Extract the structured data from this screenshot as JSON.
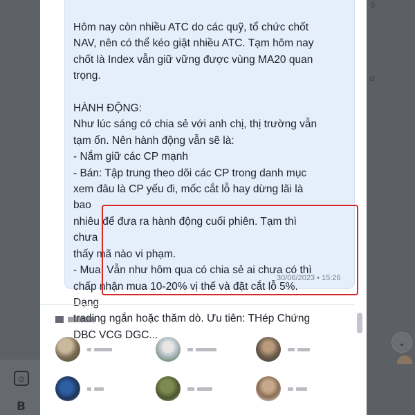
{
  "message": {
    "text": "Hôm nay còn nhiều ATC do các quỹ, tổ chức chốt\nNAV, nên có thể kéo giật nhiều ATC. Tạm hôm nay\nchốt là Index vẫn giữ vững được vùng MA20 quan\ntrọng.\n\nHÀNH ĐỘNG:\nNhư lúc sáng có chia sẻ với anh chị, thị trường vẫn\ntạm ổn. Nên hành động vẫn sẽ là:\n- Nắm giữ các CP mạnh\n- Bán: Tập trung theo dõi các CP trong danh mục\nxem đâu là CP yếu đi, mốc cắt lỗ hay dừng lãi là bao\nnhiêu để đưa ra hành động cuối phiên. Tạm thì chưa\nthấy mã nào vi phạm.\n- Mua: Vẫn như hôm qua có chia sẻ ai chưa có thì\nchấp nhận mua 10-20% vị thế và đặt cắt lỗ 5%. Dạng\ntrading ngắn hoặc thăm dò. Ưu tiên: THép Chứng\nDBC VCG DGC...",
    "timestamp": "30/06/2023 • 15:26"
  },
  "highlight_color": "#d62828",
  "bubble_color": "#e5eefb",
  "background_app": {
    "left_icons": [
      "emoji-icon",
      "bold-icon"
    ],
    "bold_label": "B",
    "right_chevron": "⌄"
  },
  "contacts": [
    {
      "avatar": "av1"
    },
    {
      "avatar": "av2"
    },
    {
      "avatar": "av3"
    },
    {
      "avatar": "av4"
    },
    {
      "avatar": "av5"
    },
    {
      "avatar": "av6"
    }
  ]
}
